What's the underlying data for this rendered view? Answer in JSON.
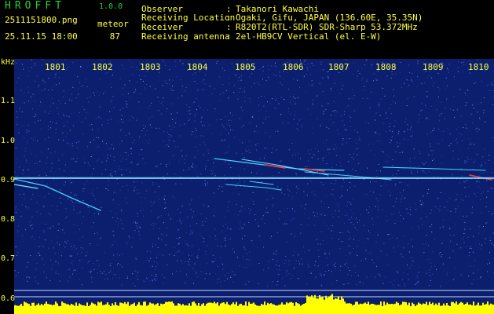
{
  "app": {
    "name": "HROFFT",
    "version": "1.0.0"
  },
  "file": {
    "name": "2511151800.png",
    "timestamp": "25.11.15 18:00"
  },
  "meteor": {
    "label": "meteor",
    "count": "87"
  },
  "info": [
    {
      "key": "Observer",
      "value": "Takanori Kawachi"
    },
    {
      "key": "Receiving Location",
      "value": "Ogaki, Gifu, JAPAN (136.60E, 35.35N)"
    },
    {
      "key": "Receiver",
      "value": "R820T2(RTL-SDR) SDR-Sharp 53.372MHz"
    },
    {
      "key": "Receiving antenna",
      "value": "2el-HB9CV Vertical (el. E-W)"
    }
  ],
  "separator": ":",
  "spectrogram": {
    "y_unit": "kHz",
    "time_labels": [
      "1801",
      "1802",
      "1803",
      "1804",
      "1805",
      "1806",
      "1807",
      "1808",
      "1809",
      "1810"
    ],
    "freq_labels": [
      "1.1",
      "1.0",
      "0.9",
      "0.8",
      "0.7",
      "0.6"
    ],
    "colors": {
      "background": "#0c1f6e",
      "carrier": "#9ef0ff",
      "trace": "#44d2ff",
      "hot": "#ff3a3a",
      "noise": "#ffff00",
      "text": "#ffff3c"
    }
  }
}
